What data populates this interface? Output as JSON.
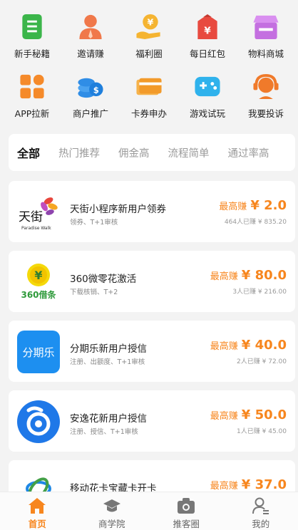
{
  "grid_row1": [
    {
      "label": "新手秘籍",
      "icon": "handbook-icon",
      "color": "#3bb54a"
    },
    {
      "label": "邀请赚",
      "icon": "invite-person-icon",
      "color": "#f0784a"
    },
    {
      "label": "福利圈",
      "icon": "welfare-hand-icon",
      "color": "#f5b431"
    },
    {
      "label": "每日红包",
      "icon": "red-packet-icon",
      "color": "#e84a3f"
    },
    {
      "label": "物料商城",
      "icon": "shop-icon",
      "color": "#c46fe0"
    }
  ],
  "grid_row2": [
    {
      "label": "APP拉新",
      "icon": "app-grid-icon",
      "color": "#f58a2a"
    },
    {
      "label": "商户推广",
      "icon": "coin-stack-icon",
      "color": "#2f8de6"
    },
    {
      "label": "卡券申办",
      "icon": "card-icon",
      "color": "#f29a2a"
    },
    {
      "label": "游戏试玩",
      "icon": "game-controller-icon",
      "color": "#2fb2ec"
    },
    {
      "label": "我要投诉",
      "icon": "headset-icon",
      "color": "#f07a2a"
    }
  ],
  "tabs": [
    "全部",
    "热门推荐",
    "佣金高",
    "流程简单",
    "通过率高"
  ],
  "cards": [
    {
      "logo": "paradise-walk-logo",
      "logo_text": "天街",
      "logo_sub": "Paradise Walk",
      "title": "天街小程序新用户领券",
      "subtitle": "领券、T+1审核",
      "earn_label": "最高赚",
      "amount": "¥ 2.0",
      "stats": "464人已赚 ¥ 835.20"
    },
    {
      "logo": "360-jietiao-logo",
      "logo_text": "360借条",
      "logo_sub": "¥",
      "title": "360微零花激活",
      "subtitle": "下载核销、T+2",
      "earn_label": "最高赚",
      "amount": "¥ 80.0",
      "stats": "3人已赚 ¥ 216.00"
    },
    {
      "logo": "fenqile-logo",
      "logo_text": "分期乐",
      "logo_sub": "",
      "title": "分期乐新用户授信",
      "subtitle": "注册、出额度、T+1审核",
      "earn_label": "最高赚",
      "amount": "¥ 40.0",
      "stats": "2人已赚 ¥ 72.00"
    },
    {
      "logo": "anyihua-logo",
      "logo_text": "",
      "logo_sub": "",
      "title": "安逸花新用户授信",
      "subtitle": "注册、授信、T+1审核",
      "earn_label": "最高赚",
      "amount": "¥ 50.0",
      "stats": "1人已赚 ¥ 45.00"
    },
    {
      "logo": "china-mobile-logo",
      "logo_text": "",
      "logo_sub": "",
      "title": "移动花卡宝藏卡开卡",
      "subtitle": "",
      "earn_label": "最高赚",
      "amount": "¥ 37.0",
      "stats": ""
    }
  ],
  "bottom_nav": [
    {
      "label": "首页",
      "icon": "home-icon",
      "active": true
    },
    {
      "label": "商学院",
      "icon": "graduation-cap-icon",
      "active": false
    },
    {
      "label": "推客圈",
      "icon": "camera-icon",
      "active": false
    },
    {
      "label": "我的",
      "icon": "profile-icon",
      "active": false
    }
  ],
  "colors": {
    "accent": "#f7861e",
    "background": "#f3f3f3"
  }
}
